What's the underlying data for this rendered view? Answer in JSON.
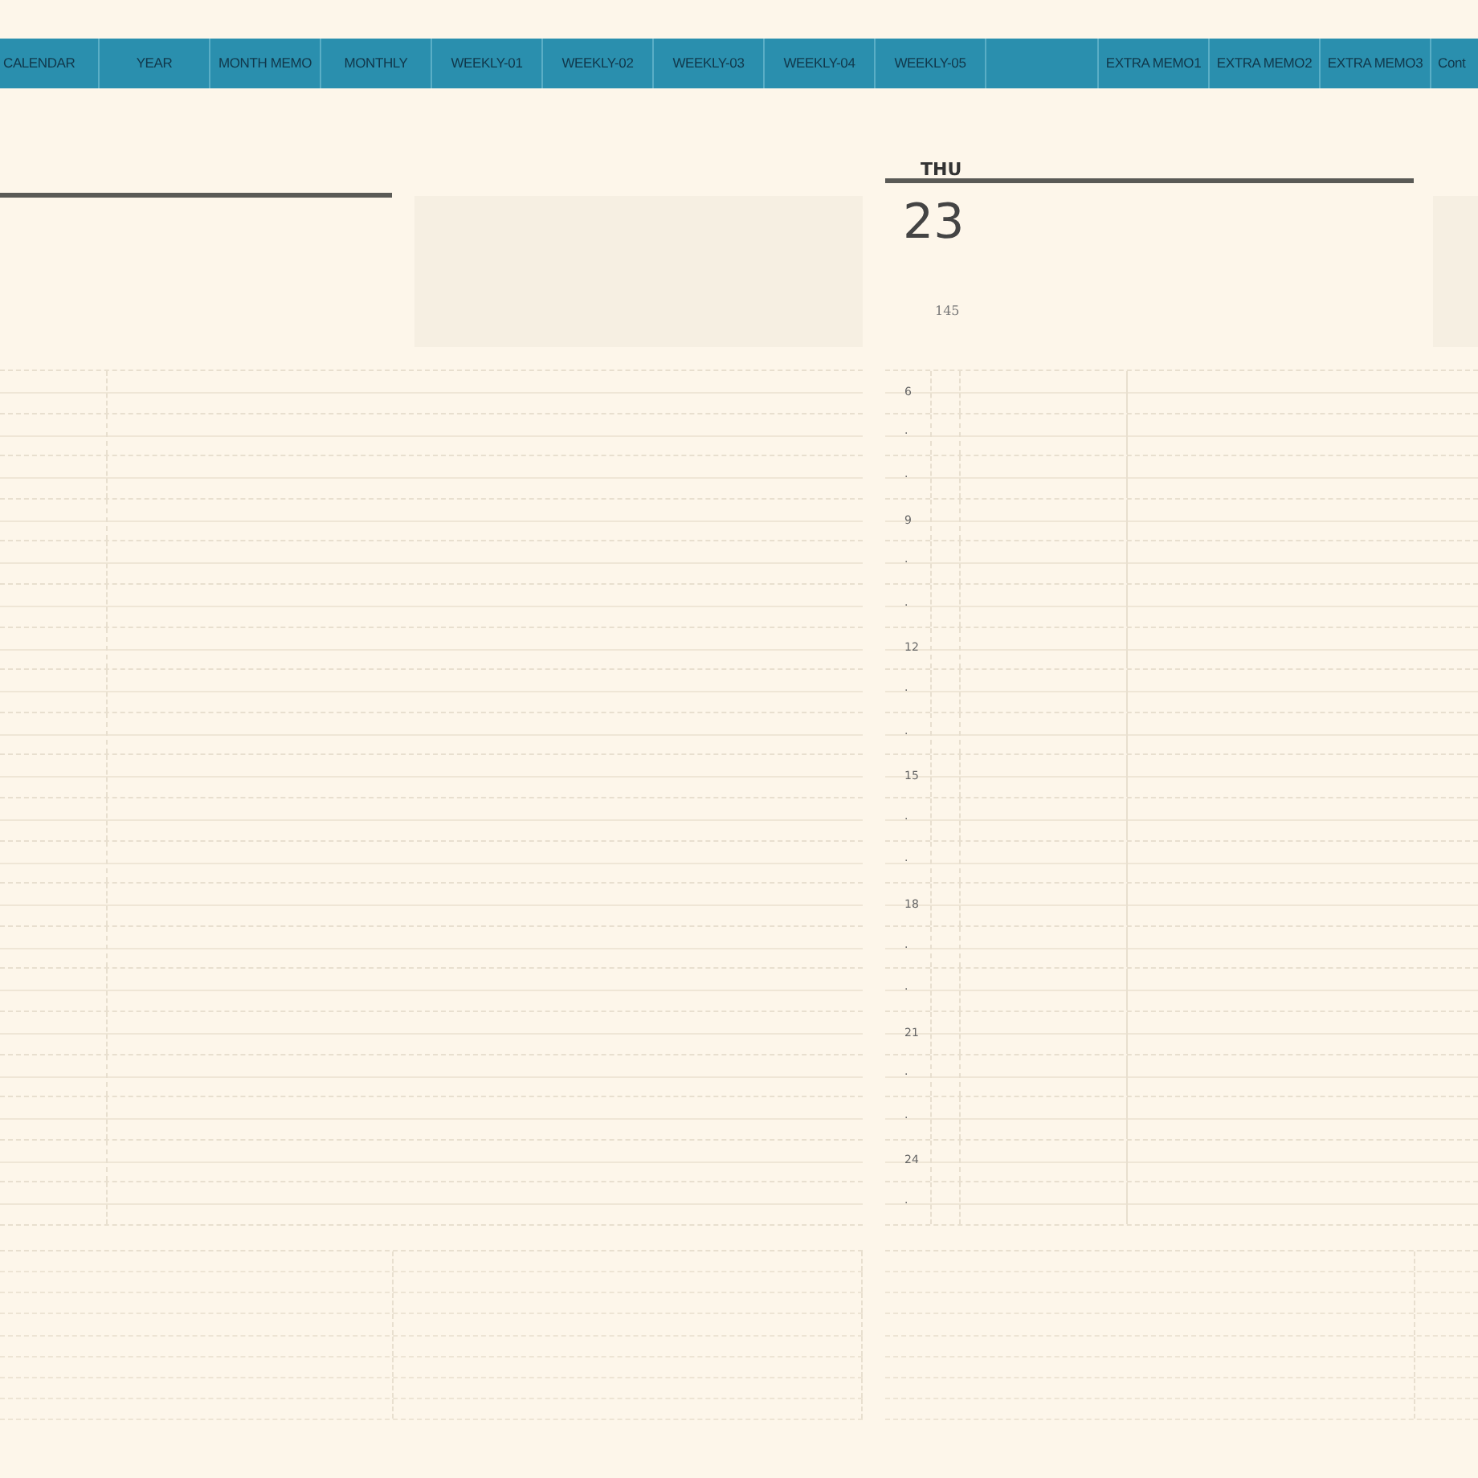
{
  "nav_tabs": [
    {
      "label": "CALENDAR"
    },
    {
      "label": "YEAR"
    },
    {
      "label": "MONTH MEMO"
    },
    {
      "label": "MONTHLY"
    },
    {
      "label": "WEEKLY-01"
    },
    {
      "label": "WEEKLY-02"
    },
    {
      "label": "WEEKLY-03"
    },
    {
      "label": "WEEKLY-04"
    },
    {
      "label": "WEEKLY-05"
    }
  ],
  "extra_tabs": [
    {
      "label": "EXTRA MEMO1"
    },
    {
      "label": "EXTRA MEMO2"
    },
    {
      "label": "EXTRA MEMO3"
    },
    {
      "label": "Cont"
    }
  ],
  "day_page": {
    "weekday": "THU",
    "date": "23",
    "day_of_year": "145",
    "hours": [
      "6",
      "·",
      "·",
      "9",
      "·",
      "·",
      "12",
      "·",
      "·",
      "15",
      "·",
      "·",
      "18",
      "·",
      "·",
      "21",
      "·",
      "·",
      "24",
      "·"
    ]
  }
}
